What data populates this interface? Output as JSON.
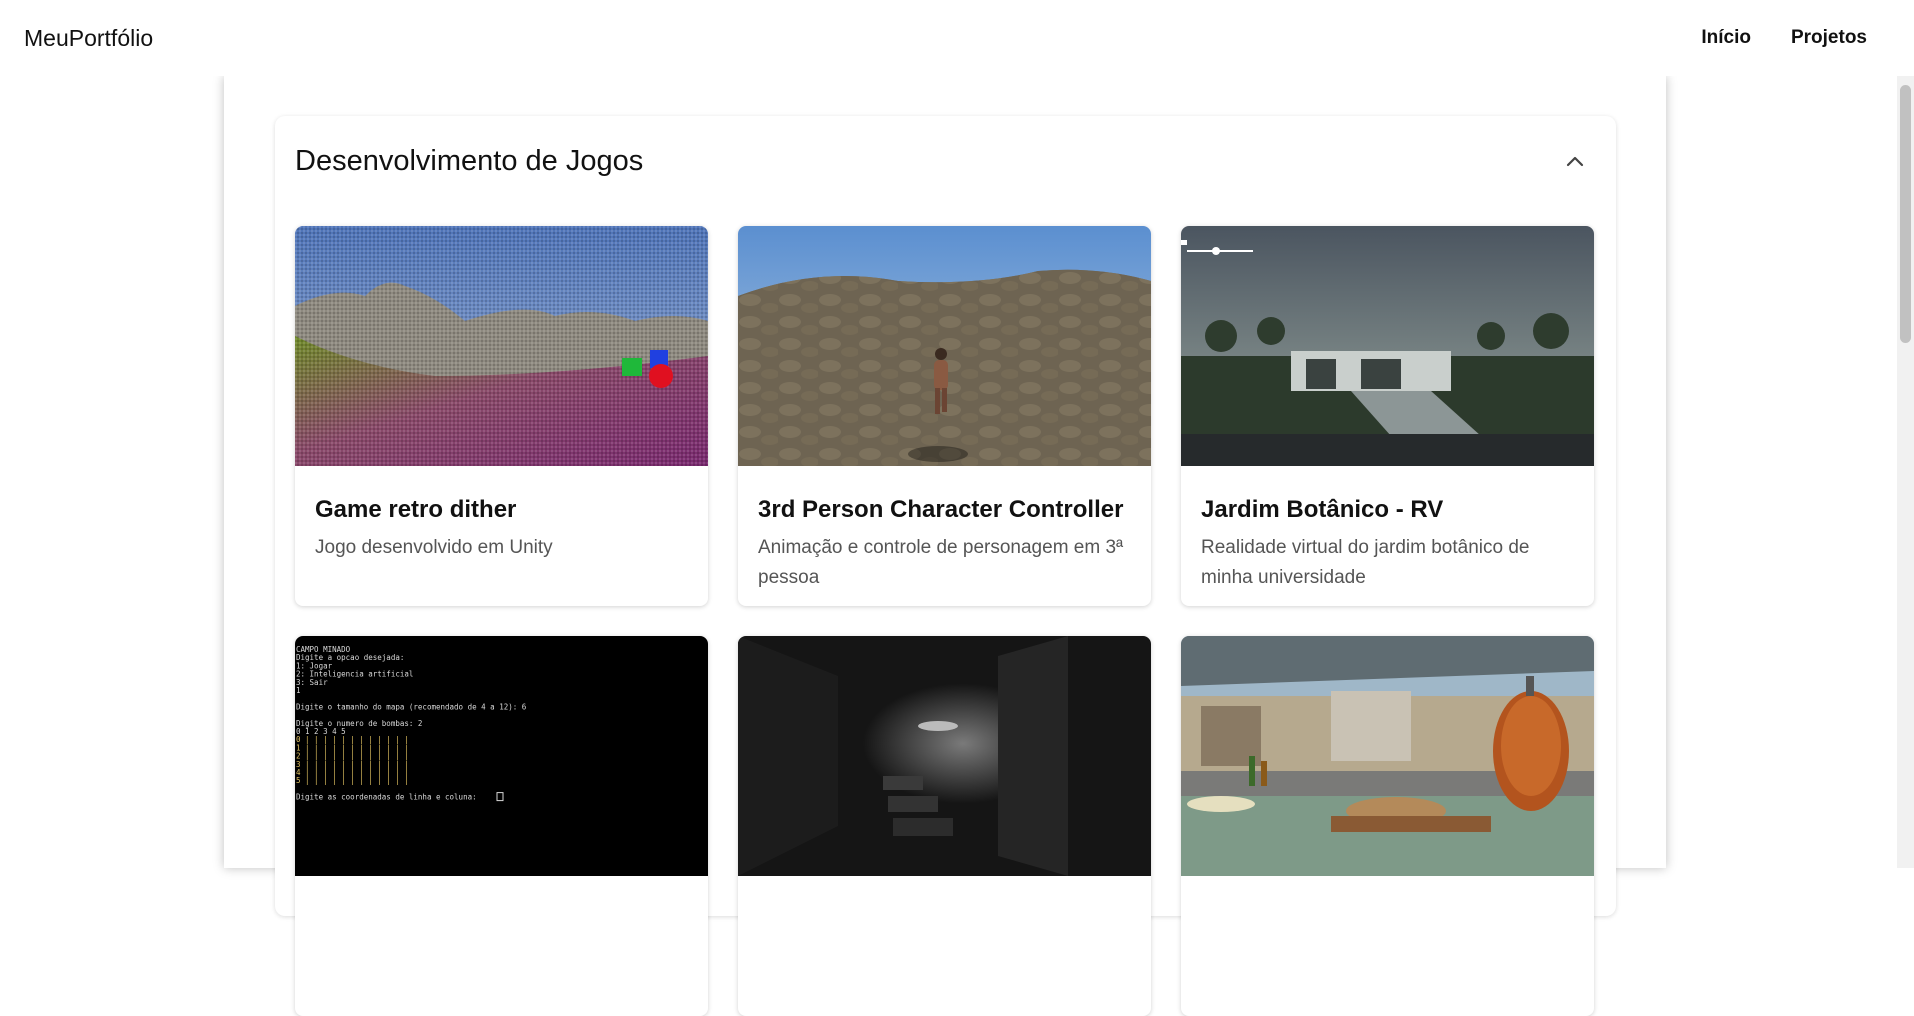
{
  "navbar": {
    "brand": "MeuPortfólio",
    "links": [
      "Início",
      "Projetos"
    ]
  },
  "section": {
    "title": "Desenvolvimento de Jogos",
    "collapse_icon": "chevron-up-icon"
  },
  "projects": [
    {
      "title": "Game retro dither",
      "description": "Jogo desenvolvido em Unity"
    },
    {
      "title": "3rd Person Character Controller",
      "description": "Animação e controle de personagem em 3ª pessoa"
    },
    {
      "title": "Jardim Botânico - RV",
      "description": "Realidade virtual do jardim botânico de minha universidade"
    },
    {
      "title": "",
      "description": ""
    },
    {
      "title": "",
      "description": ""
    },
    {
      "title": "",
      "description": ""
    }
  ],
  "terminal": {
    "lines": [
      "CAMPO MINADO",
      "Digite a opcao desejada:",
      "1: Jogar",
      "2: Inteligencia artificial",
      "3: Sair",
      "1",
      "",
      "Digite o tamanho do mapa (recomendado de 4 a 12): 6",
      "",
      "Digite o numero de bombas: 2",
      "    0  1  2  3  4  5",
      "0  | | | | | | | | | | | |",
      "1  | | | | | | | | | | | |",
      "2  | | | | | | | | | | | |",
      "3  | | | | | | | | | | | |",
      "4  | | | | | | | | | | | |",
      "5  | | | | | | | | | | | |",
      "",
      "Digite as coordenadas de linha e coluna: "
    ]
  }
}
